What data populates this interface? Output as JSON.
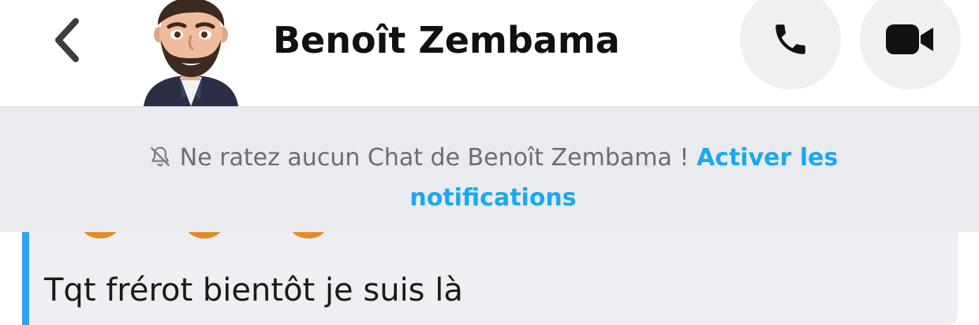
{
  "header": {
    "contact_name": "Benoît Zembama",
    "back_icon": "chevron-left-icon",
    "call_icon": "phone-icon",
    "video_icon": "video-camera-icon"
  },
  "notification_banner": {
    "icon": "bell-off-icon",
    "text": "Ne ratez aucun Chat de Benoît Zembama ! ",
    "link_label": "Activer les notifications"
  },
  "messages": [
    {
      "text": "Tqt frérot bientôt je suis là"
    }
  ],
  "colors": {
    "accent_blue": "#1ba8f0",
    "message_bar": "#2ea3f2",
    "banner_bg": "#e9ebee",
    "button_bg": "#eef0f2",
    "reaction_orange": "#e58a1f"
  }
}
